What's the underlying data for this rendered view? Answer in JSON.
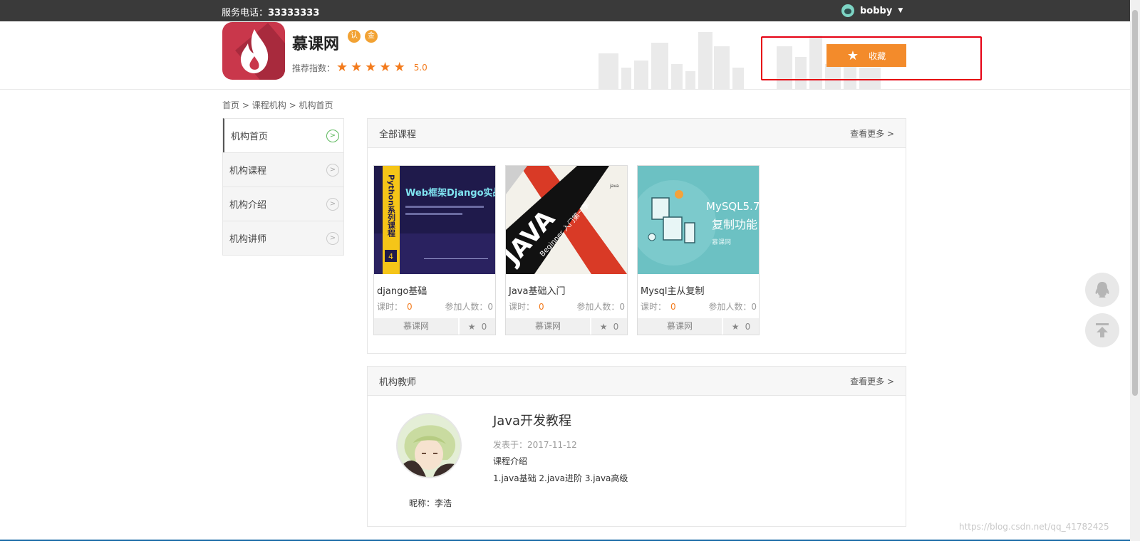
{
  "topbar": {
    "phone_label": "服务电话：",
    "phone_number": "33333333",
    "username": "bobby"
  },
  "org": {
    "name": "慕课网",
    "badge1": "认",
    "badge2": "金",
    "rating_label": "推荐指数：",
    "rating_value": 5,
    "rating_text": "5.0",
    "favorite_label": "收藏"
  },
  "breadcrumb": {
    "home": "首页",
    "sep": ">",
    "orgs": "课程机构",
    "current": "机构首页"
  },
  "sidebar": {
    "items": [
      {
        "label": "机构首页",
        "active": true
      },
      {
        "label": "机构课程",
        "active": false
      },
      {
        "label": "机构介绍",
        "active": false
      },
      {
        "label": "机构讲师",
        "active": false
      }
    ]
  },
  "courses_panel": {
    "title": "全部课程",
    "more": "查看更多 >",
    "hours_label": "课时：",
    "students_label": "参加人数：",
    "courses": [
      {
        "title": "django基础",
        "hours": "0",
        "students": "0",
        "org": "慕课网",
        "favs": "0",
        "cover_text1": "Web框架Django实战",
        "cover_text2": "Python系列课程",
        "cover_num": "4"
      },
      {
        "title": "Java基础入门",
        "hours": "0",
        "students": "0",
        "org": "慕课网",
        "favs": "0",
        "cover_text1": "JAVA",
        "cover_text2": "Beginner 入门第一季",
        "cover_num": "java"
      },
      {
        "title": "Mysql主从复制",
        "hours": "0",
        "students": "0",
        "org": "慕课网",
        "favs": "0",
        "cover_text1": "MySQL5.7",
        "cover_text2": "复制功能",
        "cover_num": "慕课网"
      }
    ]
  },
  "teachers_panel": {
    "title": "机构教师",
    "more": "查看更多 >",
    "teacher": {
      "course_title": "Java开发教程",
      "date_label": "发表于：",
      "date": "2017-11-12",
      "intro_label": "课程介绍",
      "intro": "1.java基础 2.java进阶 3.java高级",
      "nickname_label": "昵称：",
      "nickname": "李浩"
    }
  },
  "watermark": "https://blog.csdn.net/qq_41782425",
  "colors": {
    "accent": "#f37b1d",
    "favorite_btn": "#f38b2b",
    "highlight_box": "#e60012",
    "topbar": "#3a3a3a"
  }
}
